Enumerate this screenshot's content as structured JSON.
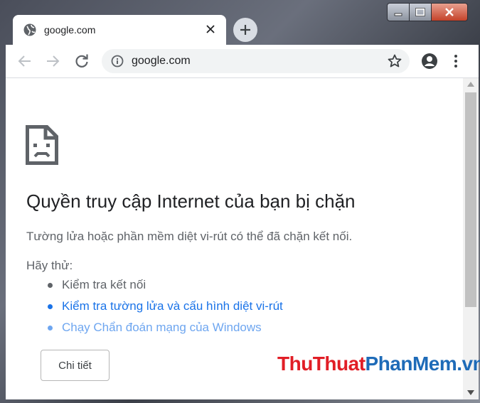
{
  "browser": {
    "tab": {
      "title": "google.com",
      "icon": "globe-icon"
    },
    "address_bar": {
      "url": "google.com"
    }
  },
  "error_page": {
    "heading": "Quyền truy cập Internet của bạn bị chặn",
    "description": "Tường lửa hoặc phần mềm diệt vi-rút có thể đã chặn kết nối.",
    "try_label": "Hãy thử:",
    "suggestions": [
      {
        "text": "Kiểm tra kết nối",
        "link": false
      },
      {
        "text": "Kiểm tra tường lửa và cấu hình diệt vi-rút",
        "link": true
      },
      {
        "text": "Chạy Chẩn đoán mạng của Windows",
        "link": true
      }
    ],
    "details_button": "Chi tiết"
  },
  "watermark": {
    "part1": "ThuThuat",
    "part2": "PhanMem",
    "part3": ".vn"
  },
  "colors": {
    "link": "#1a73e8",
    "heading": "#202124",
    "body_text": "#5f6368",
    "watermark_red": "#e11e26",
    "watermark_blue": "#1e6bb8"
  }
}
